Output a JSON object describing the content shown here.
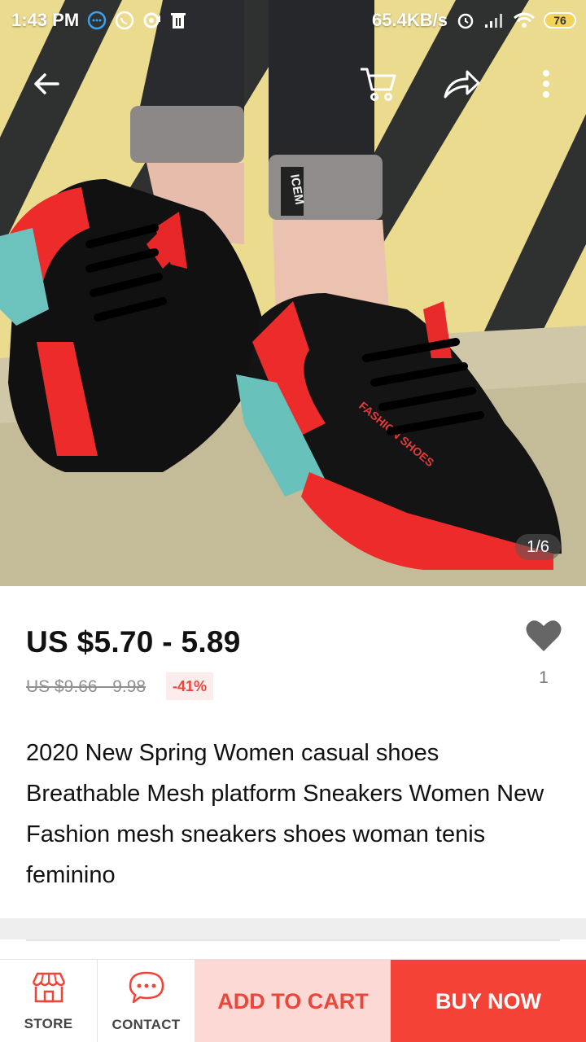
{
  "status_bar": {
    "time": "1:43 PM",
    "network_speed": "65.4KB/s",
    "battery_level": "76"
  },
  "top_bar": {
    "icons": [
      "back-arrow-icon",
      "cart-icon",
      "share-icon",
      "more-vertical-icon"
    ]
  },
  "gallery": {
    "indicator": "1/6",
    "shoe_print": "FASHION SHOES",
    "sock_print": "ICEM"
  },
  "product": {
    "price": "US $5.70 - 5.89",
    "original_price": "US $9.66 - 9.98",
    "discount": "-41%",
    "wishlist_count": "1",
    "title": "2020 New Spring Women casual shoes Breathable Mesh platform Sneakers Women New Fashion mesh sneakers shoes woman tenis feminino"
  },
  "bottom_bar": {
    "store_label": "STORE",
    "contact_label": "CONTACT",
    "add_to_cart_label": "ADD TO CART",
    "buy_now_label": "BUY NOW"
  },
  "colors": {
    "accent_red": "#f44336",
    "light_red": "#fdd9d6",
    "discount_text": "#e9463c"
  }
}
